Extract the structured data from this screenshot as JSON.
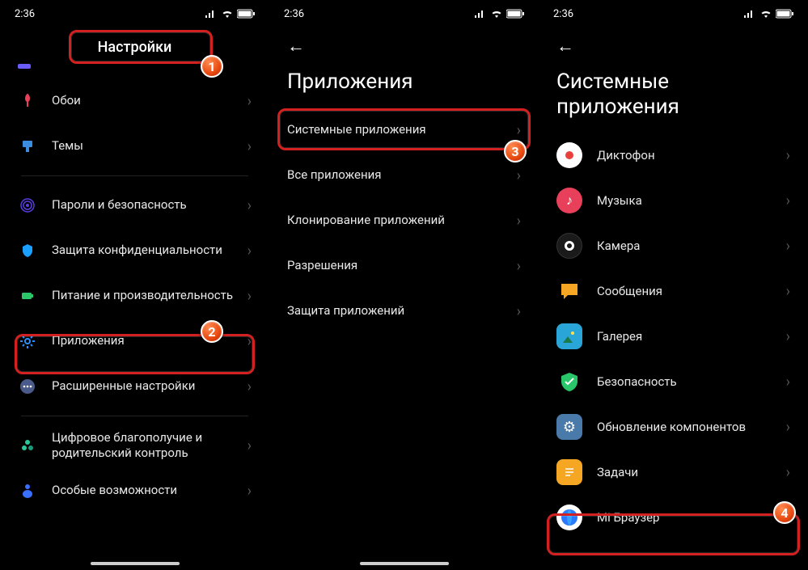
{
  "status": {
    "time": "2:36"
  },
  "panel1": {
    "title": "Настройки",
    "items": [
      {
        "label": "Обои"
      },
      {
        "label": "Темы"
      },
      {
        "label": "Пароли и безопасность"
      },
      {
        "label": "Защита конфиденциальности"
      },
      {
        "label": "Питание и производительность"
      },
      {
        "label": "Приложения"
      },
      {
        "label": "Расширенные настройки"
      },
      {
        "label": "Цифровое благополучие и родительский контроль"
      },
      {
        "label": "Особые возможности"
      }
    ]
  },
  "panel2": {
    "title": "Приложения",
    "items": [
      {
        "label": "Системные приложения"
      },
      {
        "label": "Все приложения"
      },
      {
        "label": "Клонирование приложений"
      },
      {
        "label": "Разрешения"
      },
      {
        "label": "Защита приложений"
      }
    ]
  },
  "panel3": {
    "title": "Системные приложения",
    "items": [
      {
        "label": "Диктофон"
      },
      {
        "label": "Музыка"
      },
      {
        "label": "Камера"
      },
      {
        "label": "Сообщения"
      },
      {
        "label": "Галерея"
      },
      {
        "label": "Безопасность"
      },
      {
        "label": "Обновление компонентов"
      },
      {
        "label": "Задачи"
      },
      {
        "label": "Mi Браузер"
      }
    ]
  },
  "badges": {
    "b1": "1",
    "b2": "2",
    "b3": "3",
    "b4": "4"
  }
}
